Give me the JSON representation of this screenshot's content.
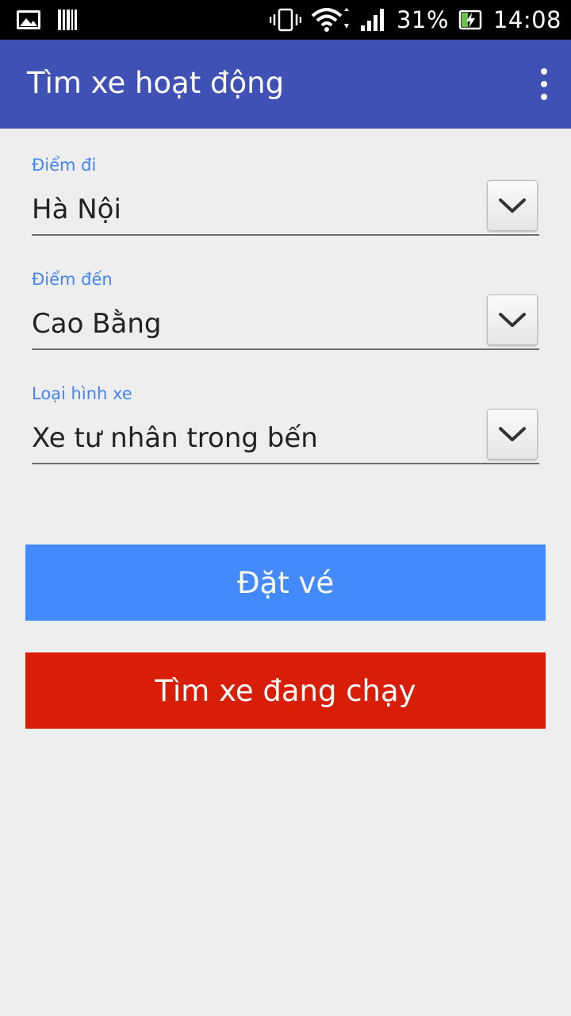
{
  "status_bar": {
    "battery_percent": "31%",
    "time": "14:08",
    "icons": [
      "gallery-icon",
      "barcode-icon",
      "vibrate-icon",
      "wifi-icon",
      "signal-icon",
      "battery-charging-icon"
    ]
  },
  "app_bar": {
    "title": "Tìm xe hoạt động",
    "menu_icon": "overflow-menu-icon"
  },
  "form": {
    "departure": {
      "label": "Điểm đi",
      "value": "Hà Nội"
    },
    "destination": {
      "label": "Điểm đến",
      "value": "Cao Bằng"
    },
    "vehicle_type": {
      "label": "Loại hình xe",
      "value": "Xe tư nhân trong bến"
    }
  },
  "actions": {
    "book_label": "Đặt vé",
    "find_running_label": "Tìm xe đang chạy"
  },
  "colors": {
    "app_bar": "#3f51b5",
    "label_blue": "#4285f4",
    "book_button": "#448aff",
    "find_button": "#d81e06",
    "background": "#eeeeee"
  }
}
